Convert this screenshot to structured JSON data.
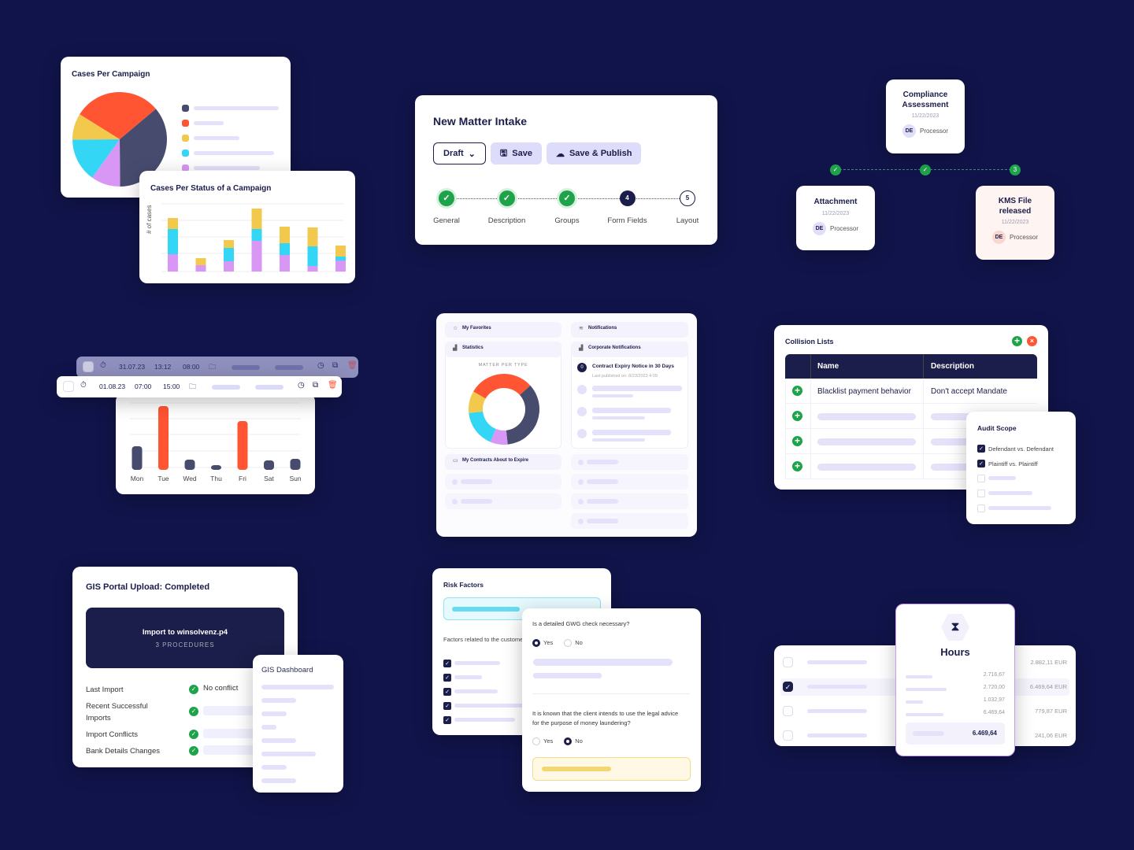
{
  "colors": {
    "background": "#11144a",
    "navy": "#1b1d4a",
    "slate": "#474b6e",
    "red": "#ff5533",
    "yellow": "#f2c94c",
    "cyan": "#33d6f5",
    "purple": "#d896f5",
    "green": "#1fa34a"
  },
  "cases_campaign": {
    "title": "Cases Per Campaign",
    "slices": [
      {
        "color": "#ff5533",
        "value": 30
      },
      {
        "color": "#474b6e",
        "value": 36
      },
      {
        "color": "#d896f5",
        "value": 10
      },
      {
        "color": "#33d6f5",
        "value": 15
      },
      {
        "color": "#f2c94c",
        "value": 9
      }
    ]
  },
  "cases_status": {
    "title": "Cases Per Status of a Campaign",
    "ylabel": "# of cases",
    "bars": [
      {
        "purple": 22,
        "cyan": 32,
        "yellow": 14
      },
      {
        "purple": 8,
        "cyan": 0,
        "yellow": 9
      },
      {
        "purple": 13,
        "cyan": 17,
        "yellow": 10
      },
      {
        "purple": 39,
        "cyan": 15,
        "yellow": 26
      },
      {
        "purple": 21,
        "cyan": 15,
        "yellow": 21
      },
      {
        "purple": 7,
        "cyan": 25,
        "yellow": 24
      },
      {
        "purple": 14,
        "cyan": 5,
        "yellow": 14
      }
    ]
  },
  "matter_intake": {
    "title": "New Matter Intake",
    "draft": "Draft",
    "save": "Save",
    "save_publish": "Save & Publish",
    "steps": [
      {
        "label": "General",
        "state": "done"
      },
      {
        "label": "Description",
        "state": "done"
      },
      {
        "label": "Groups",
        "state": "done"
      },
      {
        "label": "Form Fields",
        "state": "current",
        "num": "4"
      },
      {
        "label": "Layout",
        "state": "todo",
        "num": "5"
      }
    ]
  },
  "timeline": {
    "compliance": {
      "title": "Compliance Assessment",
      "date": "11/22/2023",
      "initials": "DE",
      "role": "Processor"
    },
    "attachment": {
      "title": "Attachment",
      "date": "11/22/2023",
      "initials": "DE",
      "role": "Processor"
    },
    "kms": {
      "title": "KMS File released",
      "date": "11/22/2023",
      "initials": "DE",
      "role": "Processor",
      "step": "3"
    }
  },
  "timesheet": {
    "rows": [
      {
        "date": "31.07.23",
        "start": "13:12",
        "end": "08:00"
      },
      {
        "date": "01.08.23",
        "start": "07:00",
        "end": "15:00"
      }
    ],
    "days": [
      "Mon",
      "Tue",
      "Wed",
      "Thu",
      "Fri",
      "Sat",
      "Sun"
    ],
    "values": [
      30,
      81,
      13,
      6,
      62,
      12,
      14
    ],
    "highlight": [
      false,
      true,
      false,
      false,
      true,
      false,
      false
    ]
  },
  "dashboard": {
    "favorites": "My Favorites",
    "notifications": "Notifications",
    "statistics": "Statistics",
    "corporate": "Corporate Notifications",
    "matter_type": "MATTER PER TYPE",
    "notice_badge": "0",
    "notice_title": "Contract Expiry Notice in 30 Days",
    "notice_date": "Last published on: 8/23/2023 4:09",
    "contracts": "My Contracts About to Expire",
    "donut": [
      {
        "color": "#ff5533",
        "value": 30
      },
      {
        "color": "#474b6e",
        "value": 35
      },
      {
        "color": "#d896f5",
        "value": 8
      },
      {
        "color": "#33d6f5",
        "value": 17
      },
      {
        "color": "#f2c94c",
        "value": 10
      }
    ]
  },
  "collision": {
    "title": "Collision Lists",
    "col_name": "Name",
    "col_desc": "Description",
    "row_name": "Blacklist payment behavior",
    "row_desc": "Don't accept Mandate"
  },
  "audit": {
    "title": "Audit Scope",
    "items": [
      "Defendant vs. Defendant",
      "Plaintiff vs. Plaintiff"
    ]
  },
  "gis": {
    "title": "GIS Portal Upload: Completed",
    "import_title": "Import to winsolvenz.p4",
    "import_sub": "3 PROCEDURES",
    "rows": [
      "Last Import",
      "Recent Successful Imports",
      "Import Conflicts",
      "Bank Details Changes"
    ],
    "no_conflict": "No conflict",
    "dashboard": "GIS Dashboard"
  },
  "risk": {
    "title": "Risk Factors",
    "factors": "Factors related to the customer, transaction or distribution:",
    "q1": "Is a detailed GWG check necessary?",
    "q2": "It is known that the client intends to use the legal advice for the purpose of money laundering?",
    "yes": "Yes",
    "no": "No",
    "q1_answer": "Yes",
    "q2_answer": "No"
  },
  "hours": {
    "title": "Hours",
    "values": [
      "2.716,67",
      "2.720,00",
      "1.032,97",
      "6.469,64"
    ],
    "total": "6.469,64",
    "amounts": [
      "2.882,11 EUR",
      "6.469,64 EUR",
      "779,87 EUR",
      "241,06 EUR"
    ],
    "checked_row": 1
  }
}
